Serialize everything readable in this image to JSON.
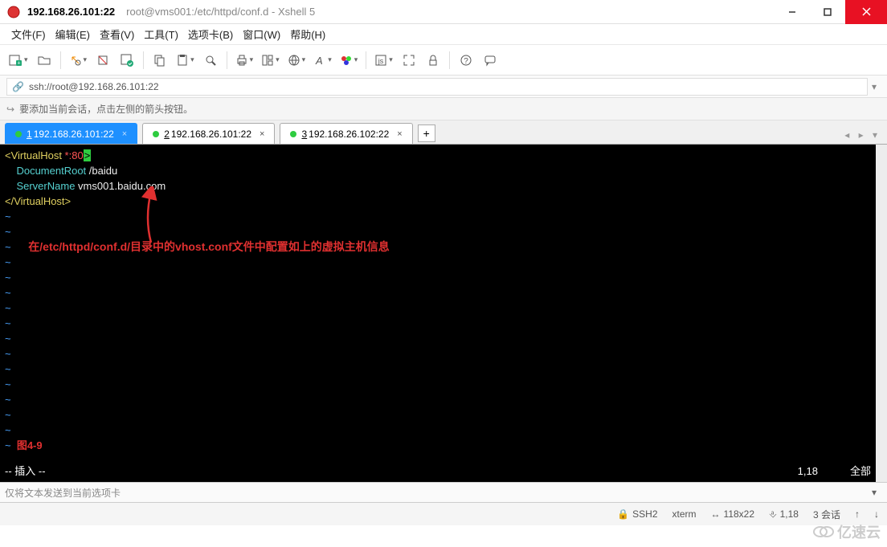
{
  "window": {
    "title_main": "192.168.26.101:22",
    "title_sub": "root@vms001:/etc/httpd/conf.d - Xshell 5"
  },
  "menu": {
    "file": "文件(F)",
    "edit": "编辑(E)",
    "view": "查看(V)",
    "tools": "工具(T)",
    "tab": "选项卡(B)",
    "window": "窗口(W)",
    "help": "帮助(H)"
  },
  "address": {
    "url": "ssh://root@192.168.26.101:22"
  },
  "hint": {
    "text": "要添加当前会话，点击左侧的箭头按钮。"
  },
  "tabs": {
    "items": [
      {
        "num": "1",
        "label": "192.168.26.101:22",
        "active": true
      },
      {
        "num": "2",
        "label": "192.168.26.101:22",
        "active": false
      },
      {
        "num": "3",
        "label": "192.168.26.102:22",
        "active": false
      }
    ]
  },
  "terminal": {
    "l1_a": "<VirtualHost ",
    "l1_b": "*:80",
    "l1_c": ">",
    "l2_a": "DocumentRoot",
    "l2_b": " /baidu",
    "l3_a": "ServerName",
    "l3_b": " vms001.baidu.com",
    "l4": "</VirtualHost>",
    "annotation": "在/etc/httpd/conf.d/目录中的vhost.conf文件中配置如上的虚拟主机信息",
    "figure": "图4-9",
    "mode": "-- 插入 --",
    "pos": "1,18",
    "scroll": "全部"
  },
  "sendbar": {
    "placeholder": "仅将文本发送到当前选项卡"
  },
  "status": {
    "proto": "SSH2",
    "term": "xterm",
    "size": "118x22",
    "cursor": "1,18",
    "sessions": "3 会话"
  },
  "watermark": "亿速云"
}
